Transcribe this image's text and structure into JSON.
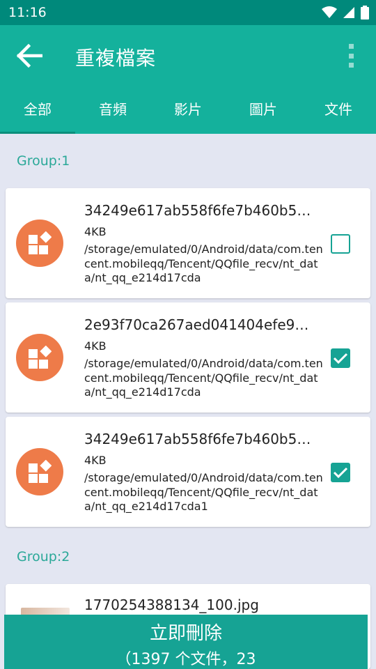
{
  "status_bar": {
    "time": "11:16"
  },
  "app_bar": {
    "title": "重複檔案"
  },
  "tabs": [
    {
      "label": "全部",
      "active": true
    },
    {
      "label": "音頻",
      "active": false
    },
    {
      "label": "影片",
      "active": false
    },
    {
      "label": "圖片",
      "active": false
    },
    {
      "label": "文件",
      "active": false
    }
  ],
  "groups": [
    {
      "label": "Group:1",
      "items": [
        {
          "name": "34249e617ab558f6fe7b460b5…",
          "size": "4KB",
          "path": "/storage/emulated/0/Android/data/com.tencent.mobileqq/Tencent/QQfile_recv/nt_data/nt_qq_e214d17cda",
          "checked": false
        },
        {
          "name": "2e93f70ca267aed041404efe9…",
          "size": "4KB",
          "path": "/storage/emulated/0/Android/data/com.tencent.mobileqq/Tencent/QQfile_recv/nt_data/nt_qq_e214d17cda",
          "checked": true
        },
        {
          "name": "34249e617ab558f6fe7b460b5…",
          "size": "4KB",
          "path": "/storage/emulated/0/Android/data/com.tencent.mobileqq/Tencent/QQfile_recv/nt_data/nt_qq_e214d17cda1",
          "checked": true
        }
      ]
    },
    {
      "label": "Group:2",
      "items": [
        {
          "name": "1770254388134_100.jpg"
        }
      ]
    }
  ],
  "delete_bar": {
    "title": "立即刪除",
    "subtitle": "（1397 个文件，23"
  },
  "colors": {
    "status_bar": "#00897b",
    "app_bar": "#14b19c",
    "accent": "#16a394",
    "file_icon": "#ee7b49",
    "background": "#e3e6f2"
  },
  "icons": {
    "back": "arrow-left-icon",
    "more": "more-vert-icon",
    "file": "file-grid-icon",
    "checkbox_checked": "check-icon"
  }
}
